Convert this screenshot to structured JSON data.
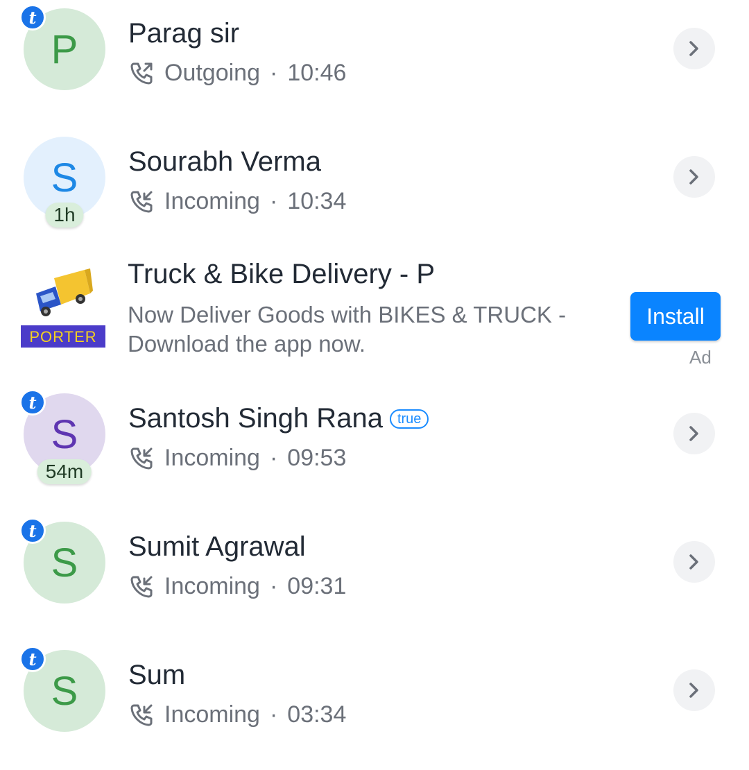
{
  "calls": [
    {
      "name": "Parag sir",
      "initial": "P",
      "type": "Outgoing",
      "time": "10:46",
      "pill": null,
      "badge": true,
      "true_tag": null,
      "avatar_bg": "#d5ead8",
      "avatar_fg": "#3c9a48"
    },
    {
      "name": "Sourabh Verma",
      "initial": "S",
      "type": "Incoming",
      "time": "10:34",
      "pill": "1h",
      "badge": false,
      "true_tag": null,
      "avatar_bg": "#e3f0fd",
      "avatar_fg": "#1e88e5"
    },
    {
      "name": "Santosh Singh Rana",
      "initial": "S",
      "type": "Incoming",
      "time": "09:53",
      "pill": "54m",
      "badge": true,
      "true_tag": "true",
      "avatar_bg": "#e0d8ee",
      "avatar_fg": "#5e35b1"
    },
    {
      "name": "Sumit Agrawal",
      "initial": "S",
      "type": "Incoming",
      "time": "09:31",
      "pill": null,
      "badge": true,
      "true_tag": null,
      "avatar_bg": "#d5ead8",
      "avatar_fg": "#3c9a48"
    },
    {
      "name": "Sum",
      "initial": "S",
      "type": "Incoming",
      "time": "03:34",
      "pill": null,
      "badge": true,
      "true_tag": null,
      "avatar_bg": "#d5ead8",
      "avatar_fg": "#3c9a48"
    }
  ],
  "badge_letter": "t",
  "separator": "·",
  "ad": {
    "title": "Truck & Bike Delivery - P",
    "description": "Now Deliver Goods with BIKES & TRUCK - Download the app now.",
    "logo_text": "PORTER",
    "install_label": "Install",
    "ad_label": "Ad"
  },
  "icons": {
    "outgoing": "outgoing-call-icon",
    "incoming": "incoming-call-icon",
    "chevron": "chevron-right-icon"
  },
  "colors": {
    "accent": "#0a84ff",
    "badge": "#1a73e8"
  }
}
